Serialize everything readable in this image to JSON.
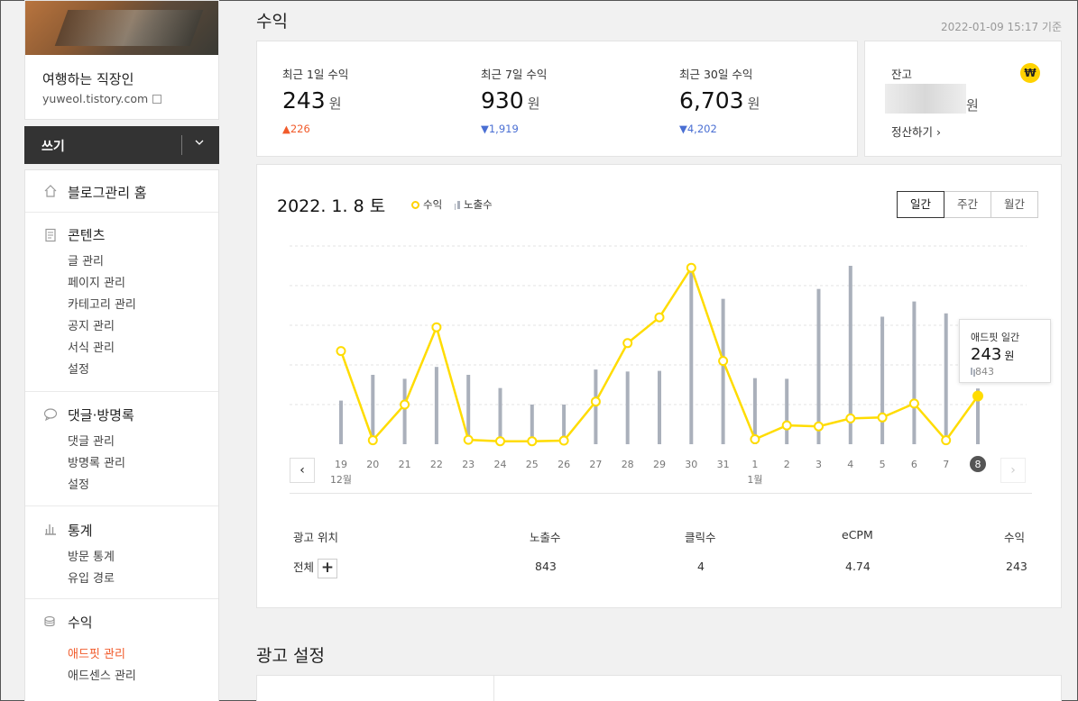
{
  "sidebar": {
    "blog_name": "여행하는 직장인",
    "blog_url": "yuweol.tistory.com",
    "write_label": "쓰기",
    "sections": [
      {
        "title": "블로그관리 홈",
        "icon": "home-icon",
        "items": []
      },
      {
        "title": "콘텐츠",
        "icon": "document-icon",
        "items": [
          "글 관리",
          "페이지 관리",
          "카테고리 관리",
          "공지 관리",
          "서식 관리",
          "설정"
        ]
      },
      {
        "title": "댓글·방명록",
        "icon": "speech-bubble-icon",
        "items": [
          "댓글 관리",
          "방명록 관리",
          "설정"
        ]
      },
      {
        "title": "통계",
        "icon": "bar-chart-icon",
        "items": [
          "방문 통계",
          "유입 경로"
        ]
      },
      {
        "title": "수익",
        "icon": "coins-icon",
        "items": [
          "애드핏 관리",
          "애드센스 관리"
        ],
        "active_item": "애드핏 관리"
      }
    ]
  },
  "header": {
    "title": "수익",
    "timestamp": "2022-01-09 15:17 기준"
  },
  "stats": [
    {
      "label": "최근 1일 수익",
      "value": "243",
      "unit": "원",
      "delta": "▲226",
      "direction": "up"
    },
    {
      "label": "최근 7일 수익",
      "value": "930",
      "unit": "원",
      "delta": "▼1,919",
      "direction": "down"
    },
    {
      "label": "최근 30일 수익",
      "value": "6,703",
      "unit": "원",
      "delta": "▼4,202",
      "direction": "down"
    }
  ],
  "balance": {
    "label": "잔고",
    "badge": "₩",
    "unit": "원",
    "settle_label": "정산하기"
  },
  "chart_header": {
    "date": "2022. 1. 8 토",
    "legend_revenue": "수익",
    "legend_impressions": "노출수",
    "tabs": [
      "일간",
      "주간",
      "월간"
    ],
    "active_tab": "일간",
    "prev_icon": "‹",
    "next_icon": "›"
  },
  "chart_data": {
    "type": "line",
    "categories": [
      "19",
      "20",
      "21",
      "22",
      "23",
      "24",
      "25",
      "26",
      "27",
      "28",
      "29",
      "30",
      "31",
      "1",
      "2",
      "3",
      "4",
      "5",
      "6",
      "7",
      "8"
    ],
    "month_labels": [
      {
        "index": 0,
        "label": "12월"
      },
      {
        "index": 13,
        "label": "1월"
      }
    ],
    "selected_index": 20,
    "series": [
      {
        "name": "수익",
        "kind": "line",
        "color": "#ffdc00",
        "values": [
          470,
          20,
          200,
          590,
          22,
          15,
          15,
          18,
          215,
          510,
          640,
          890,
          420,
          25,
          95,
          90,
          130,
          135,
          205,
          20,
          243
        ]
      },
      {
        "name": "노출수",
        "kind": "bar",
        "color": "#aab0bb",
        "values": [
          660,
          1050,
          990,
          1170,
          1050,
          850,
          600,
          600,
          1130,
          1100,
          1110,
          2700,
          2200,
          1000,
          990,
          2350,
          2700,
          1930,
          2160,
          1980,
          843
        ]
      }
    ]
  },
  "tooltip": {
    "title": "애드핏 일간",
    "value": "243",
    "unit": "원",
    "impressions": "843"
  },
  "table": {
    "headers": [
      "광고 위치",
      "노출수",
      "클릭수",
      "eCPM",
      "수익"
    ],
    "row": {
      "position": "전체",
      "impressions": "843",
      "clicks": "4",
      "ecpm": "4.74",
      "revenue": "243"
    }
  },
  "ad_settings_title": "광고 설정"
}
